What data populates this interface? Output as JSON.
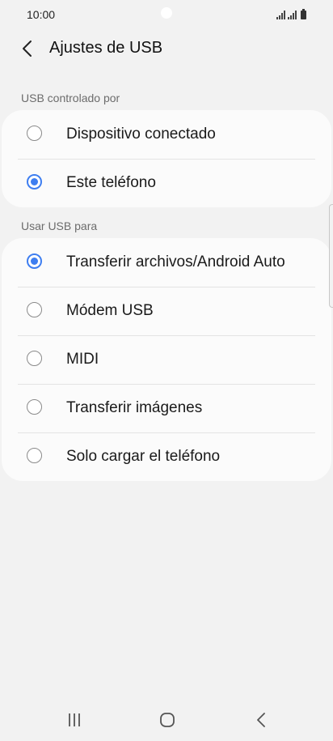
{
  "status_bar": {
    "time": "10:00"
  },
  "header": {
    "title": "Ajustes de USB"
  },
  "sections": [
    {
      "title": "USB controlado por",
      "options": [
        {
          "label": "Dispositivo conectado",
          "selected": false
        },
        {
          "label": "Este teléfono",
          "selected": true
        }
      ]
    },
    {
      "title": "Usar USB para",
      "options": [
        {
          "label": "Transferir archivos/Android Auto",
          "selected": true
        },
        {
          "label": "Módem USB",
          "selected": false
        },
        {
          "label": "MIDI",
          "selected": false
        },
        {
          "label": "Transferir imágenes",
          "selected": false
        },
        {
          "label": "Solo cargar el teléfono",
          "selected": false
        }
      ]
    }
  ],
  "colors": {
    "accent": "#3e7ef0",
    "background": "#f2f2f2",
    "card": "#fbfbfb"
  },
  "icons": [
    "back-arrow-icon",
    "signal-icon",
    "battery-icon",
    "recents-icon",
    "home-icon",
    "nav-back-icon"
  ]
}
